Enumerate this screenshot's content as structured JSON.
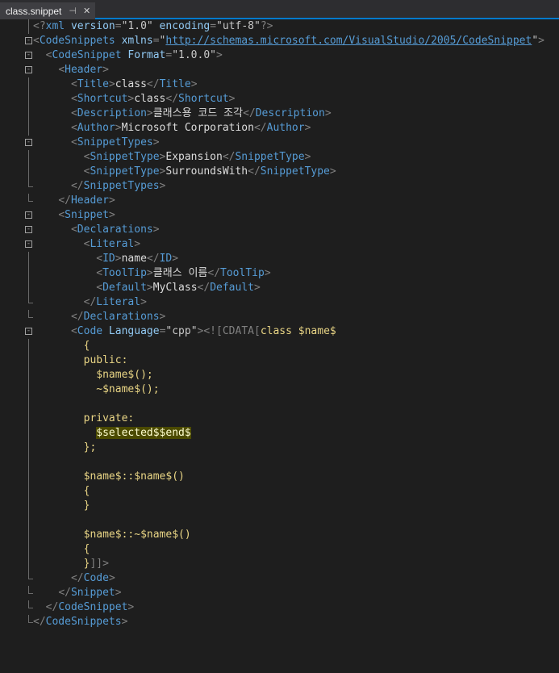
{
  "tab": {
    "title": "class.snippet",
    "pin_glyph": "⊣",
    "close_glyph": "✕"
  },
  "code": {
    "l1": {
      "open": "<?",
      "tag": "xml",
      "a1": " version",
      "eq1": "=",
      "v1": "\"1.0\"",
      "a2": " encoding",
      "eq2": "=",
      "v2": "\"utf-8\"",
      "close": "?>"
    },
    "l2": {
      "open": "<",
      "tag": "CodeSnippets",
      "a1": " xmlns",
      "eq": "=",
      "q1": "\"",
      "url": "http://schemas.microsoft.com/VisualStudio/2005/CodeSnippet",
      "q2": "\"",
      "close": ">"
    },
    "l3": {
      "open": "<",
      "tag": "CodeSnippet",
      "a1": " Format",
      "eq": "=",
      "v1": "\"1.0.0\"",
      "close": ">"
    },
    "l4": "Header",
    "l5": {
      "tag": "Title",
      "text": "class"
    },
    "l6": {
      "tag": "Shortcut",
      "text": "class"
    },
    "l7": {
      "tag": "Description",
      "text": "클래스용 코드 조각"
    },
    "l8": {
      "tag": "Author",
      "text": "Microsoft Corporation"
    },
    "l9": "SnippetTypes",
    "l10": {
      "tag": "SnippetType",
      "text": "Expansion"
    },
    "l11": {
      "tag": "SnippetType",
      "text": "SurroundsWith"
    },
    "l12": "SnippetTypes",
    "l13": "Header",
    "l14": "Snippet",
    "l15": "Declarations",
    "l16": "Literal",
    "l17": {
      "tag": "ID",
      "text": "name"
    },
    "l18": {
      "tag": "ToolTip",
      "text": "클래스 이름"
    },
    "l19": {
      "tag": "Default",
      "text": "MyClass"
    },
    "l20": "Literal",
    "l21": "Declarations",
    "l22": {
      "tag": "Code",
      "attr": " Language",
      "eq": "=",
      "val": "\"cpp\"",
      "close": ">",
      "cdata_open": "<![",
      "cdata_kw": "CDATA",
      "cdata_br": "[",
      "code": "class $name$"
    },
    "l23": "{",
    "l24": "public:",
    "l25": "$name$();",
    "l26": "~$name$();",
    "l27": "",
    "l28": "private:",
    "l29": "$selected$$end$",
    "l30": "};",
    "l31": "",
    "l32": "$name$::$name$()",
    "l33": "{",
    "l34": "}",
    "l35": "",
    "l36": "$name$::~$name$()",
    "l37": "{",
    "l38": {
      "code": "}",
      "end": "]]>"
    },
    "l39": "Code",
    "l40": "Snippet",
    "l41": "CodeSnippet",
    "l42": "CodeSnippets"
  },
  "colors": {
    "tag": "#569cd6",
    "attribute": "#92caf4",
    "text": "#dcdcdc",
    "cdata": "#e9d585",
    "accent": "#007acc"
  },
  "icons": {
    "fold": "minus-box-icon",
    "pin": "pin-icon",
    "close": "close-icon"
  }
}
